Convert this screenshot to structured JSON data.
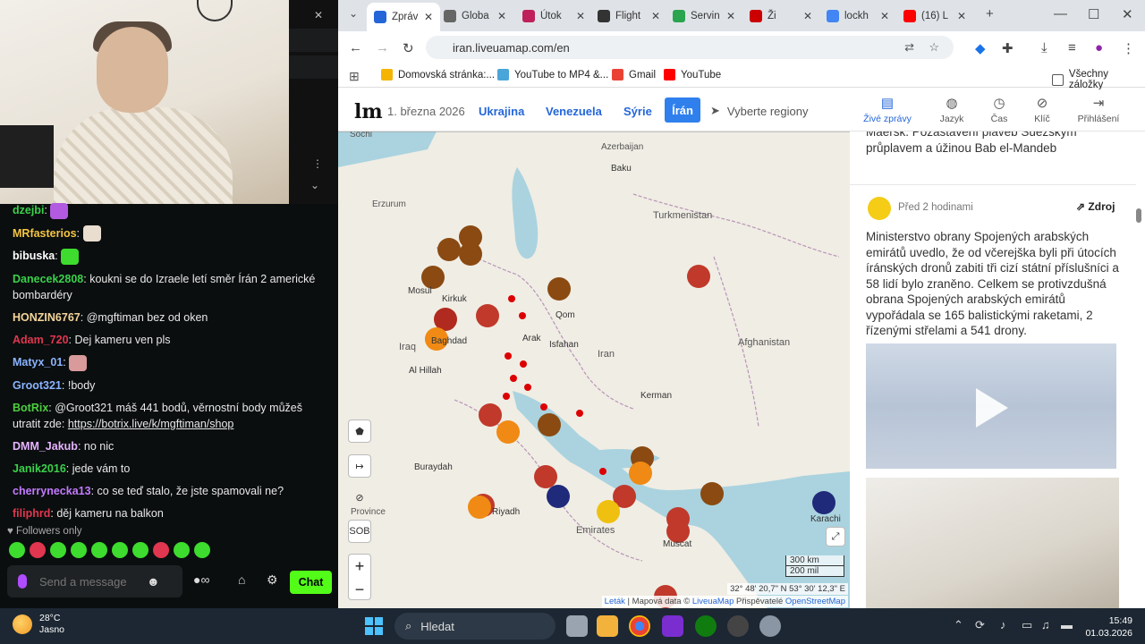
{
  "chat": {
    "messages": [
      {
        "user": "dzejbi",
        "color": "#3ad04a",
        "text": "",
        "emote": "#b25ae0"
      },
      {
        "user": "MRfasterios",
        "color": "#f4c542",
        "text": "",
        "emote": "#e9ddd0"
      },
      {
        "user": "bibuska",
        "color": "#ffffff",
        "text": "",
        "emote": "#3ddc2e"
      },
      {
        "user": "Danecek2808",
        "color": "#3ad04a",
        "text": "koukni se do Izraele letí směr Írán 2 americké bombardéry"
      },
      {
        "user": "HONZIN6767",
        "color": "#f4d59a",
        "text": "@mgftiman bez od oken"
      },
      {
        "user": "Adam_720",
        "color": "#e0364f",
        "text": "Dej kameru ven pls"
      },
      {
        "user": "Matyx_01",
        "color": "#8ab4ff",
        "text": "",
        "emote": "#d89a9a"
      },
      {
        "user": "Groot321",
        "color": "#8ab4ff",
        "text": "!body"
      },
      {
        "user": "BotRix",
        "color": "#4ccf3f",
        "text": "@Groot321 máš 441 bodů, věrnostní body můžeš utratit zde:",
        "link": "https://botrix.live/k/mgftiman/shop"
      },
      {
        "user": "DMM_Jakub",
        "color": "#e6b4ff",
        "text": "no nic"
      },
      {
        "user": "Janik2016",
        "color": "#3ad04a",
        "text": "jede vám to"
      },
      {
        "user": "cherrynecka13",
        "color": "#c27bff",
        "text": "co se teď stalo, že jste spamovali ne?"
      },
      {
        "user": "filiphrd",
        "color": "#e0364f",
        "text": "děj kameru na balkon"
      }
    ],
    "followers_only": "Followers only",
    "input_placeholder": "Send a message",
    "chat_button": "Chat"
  },
  "browser": {
    "tabs": [
      {
        "label": "Zpráv",
        "color": "#2466d8"
      },
      {
        "label": "Globa",
        "color": "#666666"
      },
      {
        "label": "Útok",
        "color": "#c0205a"
      },
      {
        "label": "Flight",
        "color": "#333333"
      },
      {
        "label": "Servin",
        "color": "#2aa44f"
      },
      {
        "label": "Ži",
        "color": "#cc0000"
      },
      {
        "label": "lockh",
        "color": "#4285f4"
      },
      {
        "label": "(16) L",
        "color": "#ff0000"
      }
    ],
    "url": "iran.liveuamap.com/en",
    "bookmarks": [
      "Domovská stránka:...",
      "YouTube to MP4 &...",
      "Gmail",
      "YouTube",
      "Všechny záložky"
    ]
  },
  "site": {
    "logo": "lm",
    "date": "1. března 2026",
    "regions": [
      "Ukrajina",
      "Venezuela",
      "Sýrie"
    ],
    "active_region": "Írán",
    "select_regions": "Vyberte regiony",
    "feed_tabs": [
      "Živé zprávy",
      "Jazyk",
      "Čas",
      "Klíč",
      "Přihlášení"
    ]
  },
  "map": {
    "labels": [
      {
        "t": "Sochi"
      },
      {
        "t": "Erzurum"
      },
      {
        "t": "Azerbaijan"
      },
      {
        "t": "Baku"
      },
      {
        "t": "Turkmenistan"
      },
      {
        "t": "Mosul"
      },
      {
        "t": "Kirkuk"
      },
      {
        "t": "Baghdad"
      },
      {
        "t": "Iraq"
      },
      {
        "t": "Arak"
      },
      {
        "t": "Qom"
      },
      {
        "t": "Isfahan"
      },
      {
        "t": "Iran"
      },
      {
        "t": "Kerman"
      },
      {
        "t": "Afghanistan"
      },
      {
        "t": "Al Hillah"
      },
      {
        "t": "Buraydah"
      },
      {
        "t": "Riyadh"
      },
      {
        "t": "Emirates"
      },
      {
        "t": "Muscat"
      },
      {
        "t": "Karachi"
      },
      {
        "t": "Province"
      }
    ],
    "sob_label": "SOB",
    "scale_km": "300 km",
    "scale_mi": "200 mil",
    "coords": "32° 48' 20,7\" N 53° 30' 12,3\" E",
    "attribution_leaflet": "Leták",
    "attribution_rest": "| Mapová data ©",
    "attribution_link": "LiveuaMap",
    "attribution_contrib": "Přispěvatelé",
    "attribution_osm": "OpenStreetMap"
  },
  "feed": {
    "prev_text": "Maersk. Pozastavení plaveb Suezským průplavem a úžinou Bab el-Mandeb",
    "post_time": "Před 2 hodinami",
    "post_source": "Zdroj",
    "post_text": "Ministerstvo obrany Spojených arabských emirátů uvedlo, že od včerejška byli při útocích íránských dronů zabiti tři cizí státní příslušníci a 58 lidí bylo zraněno. Celkem se protivzdušná obrana Spojených arabských emirátů vypořádala se 165 balistickými raketami, 2 řízenými střelami a 541 drony."
  },
  "taskbar": {
    "temp": "28°C",
    "weather": "Jasno",
    "search": "Hledat",
    "time": "15:49",
    "date": "01.03.2026"
  }
}
